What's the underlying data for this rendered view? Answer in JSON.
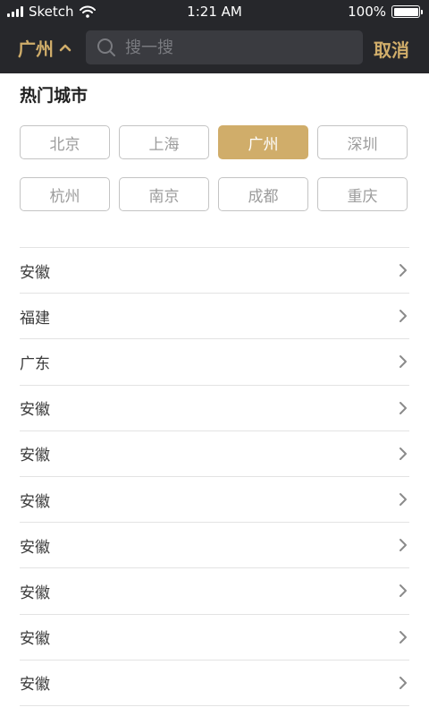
{
  "status_bar": {
    "carrier": "Sketch",
    "time": "1:21 AM",
    "battery": "100%"
  },
  "nav": {
    "current_city": "广州",
    "search_placeholder": "搜一搜",
    "cancel_label": "取消"
  },
  "hot_cities": {
    "title": "热门城市",
    "items": [
      "北京",
      "上海",
      "广州",
      "深圳",
      "杭州",
      "南京",
      "成都",
      "重庆"
    ],
    "selected": "广州"
  },
  "provinces": [
    "安徽",
    "福建",
    "广东",
    "安徽",
    "安徽",
    "安徽",
    "安徽",
    "安徽",
    "安徽",
    "安徽"
  ],
  "colors": {
    "accent": "#d0ad6a",
    "header_bg": "#26272b",
    "search_bg": "#3a3b40"
  },
  "icons": {
    "search": "search-icon",
    "city_toggle": "chevron-up-icon",
    "row_arrow": "chevron-right-icon",
    "wifi": "wifi-icon",
    "battery": "battery-icon",
    "signal": "signal-icon"
  }
}
